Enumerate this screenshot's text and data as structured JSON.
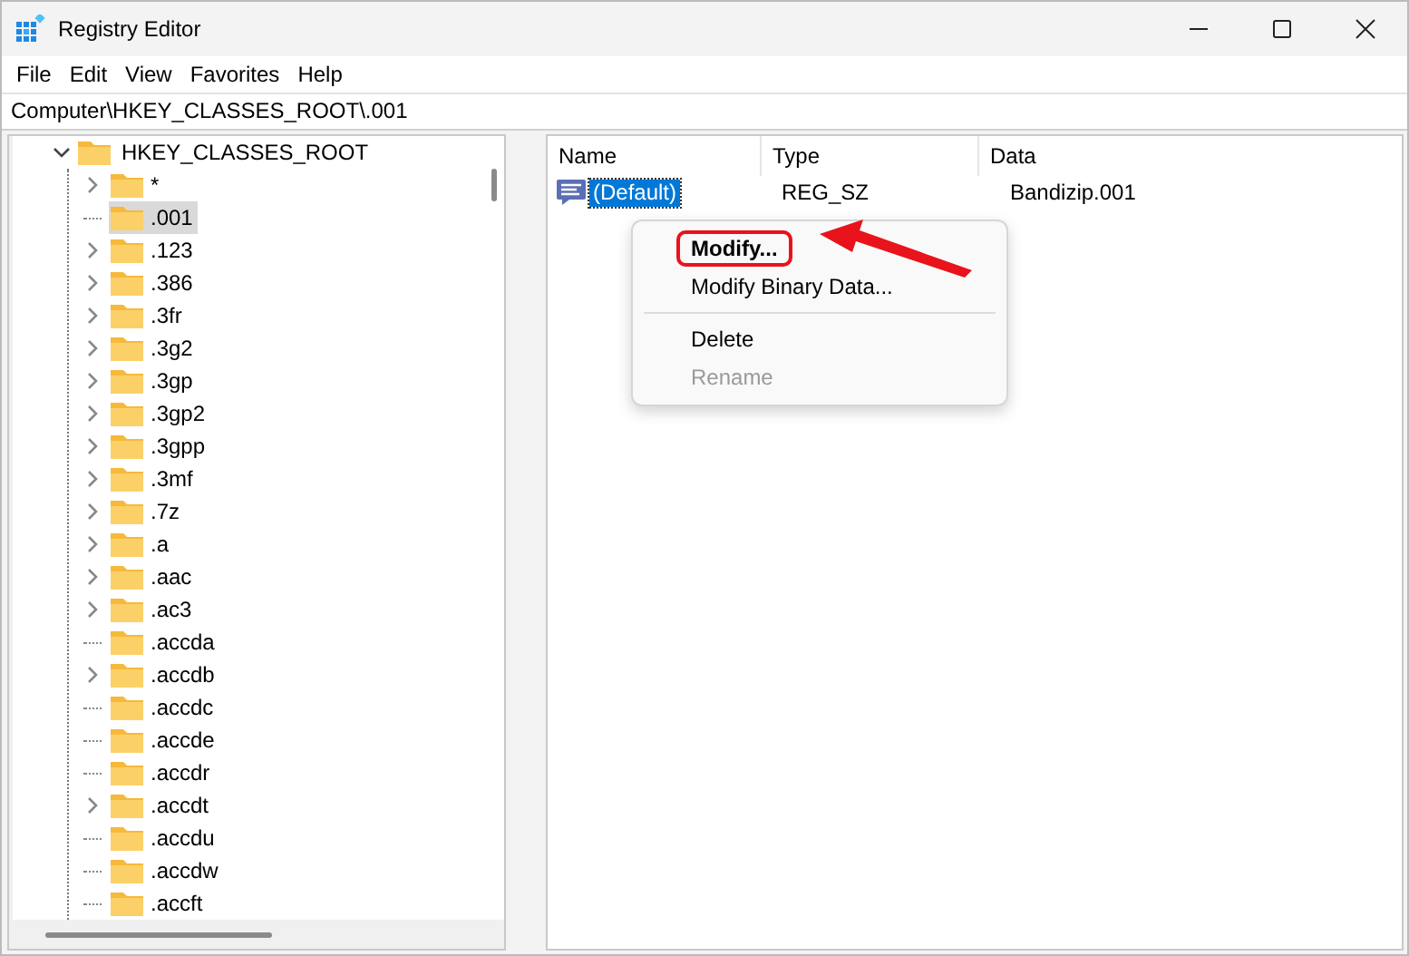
{
  "window": {
    "title": "Registry Editor"
  },
  "menu": [
    "File",
    "Edit",
    "View",
    "Favorites",
    "Help"
  ],
  "address": "Computer\\HKEY_CLASSES_ROOT\\.001",
  "tree": {
    "label": "HKEY_CLASSES_ROOT",
    "expanded": true,
    "children": [
      {
        "label": "*",
        "has_children": true,
        "selected": false
      },
      {
        "label": ".001",
        "has_children": false,
        "selected": true
      },
      {
        "label": ".123",
        "has_children": true,
        "selected": false
      },
      {
        "label": ".386",
        "has_children": true,
        "selected": false
      },
      {
        "label": ".3fr",
        "has_children": true,
        "selected": false
      },
      {
        "label": ".3g2",
        "has_children": true,
        "selected": false
      },
      {
        "label": ".3gp",
        "has_children": true,
        "selected": false
      },
      {
        "label": ".3gp2",
        "has_children": true,
        "selected": false
      },
      {
        "label": ".3gpp",
        "has_children": true,
        "selected": false
      },
      {
        "label": ".3mf",
        "has_children": true,
        "selected": false
      },
      {
        "label": ".7z",
        "has_children": true,
        "selected": false
      },
      {
        "label": ".a",
        "has_children": true,
        "selected": false
      },
      {
        "label": ".aac",
        "has_children": true,
        "selected": false
      },
      {
        "label": ".ac3",
        "has_children": true,
        "selected": false
      },
      {
        "label": ".accda",
        "has_children": false,
        "selected": false
      },
      {
        "label": ".accdb",
        "has_children": true,
        "selected": false
      },
      {
        "label": ".accdc",
        "has_children": false,
        "selected": false
      },
      {
        "label": ".accde",
        "has_children": false,
        "selected": false
      },
      {
        "label": ".accdr",
        "has_children": false,
        "selected": false
      },
      {
        "label": ".accdt",
        "has_children": true,
        "selected": false
      },
      {
        "label": ".accdu",
        "has_children": false,
        "selected": false
      },
      {
        "label": ".accdw",
        "has_children": false,
        "selected": false
      },
      {
        "label": ".accft",
        "has_children": false,
        "selected": false
      }
    ]
  },
  "table": {
    "columns": [
      "Name",
      "Type",
      "Data"
    ],
    "rows": [
      {
        "name": "(Default)",
        "type": "REG_SZ",
        "data": "Bandizip.001",
        "selected": true
      }
    ]
  },
  "context_menu": [
    {
      "kind": "item",
      "label": "Modify...",
      "default": true,
      "disabled": false,
      "highlighted": true
    },
    {
      "kind": "item",
      "label": "Modify Binary Data...",
      "default": false,
      "disabled": false,
      "highlighted": false
    },
    {
      "kind": "separator"
    },
    {
      "kind": "item",
      "label": "Delete",
      "default": false,
      "disabled": false,
      "highlighted": false
    },
    {
      "kind": "item",
      "label": "Rename",
      "default": false,
      "disabled": true,
      "highlighted": false
    }
  ]
}
